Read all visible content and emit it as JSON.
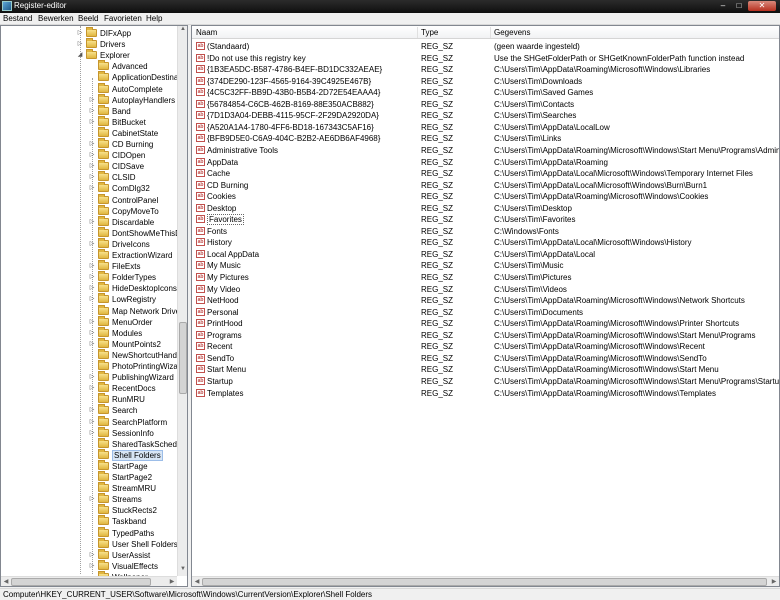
{
  "window": {
    "title": "Register-editor",
    "minimize": "–",
    "maximize": "□",
    "close": "✕"
  },
  "menu": [
    "Bestand",
    "Bewerken",
    "Beeld",
    "Favorieten",
    "Help"
  ],
  "tree": {
    "items": [
      {
        "label": "DIFxApp",
        "level": 1,
        "expander": "▷"
      },
      {
        "label": "Drivers",
        "level": 1,
        "expander": "▷"
      },
      {
        "label": "Explorer",
        "level": 1,
        "expander": "◢"
      },
      {
        "label": "Advanced",
        "level": 2,
        "expander": ""
      },
      {
        "label": "ApplicationDestinations",
        "level": 2,
        "expander": ""
      },
      {
        "label": "AutoComplete",
        "level": 2,
        "expander": ""
      },
      {
        "label": "AutoplayHandlers",
        "level": 2,
        "expander": "▷"
      },
      {
        "label": "Band",
        "level": 2,
        "expander": "▷"
      },
      {
        "label": "BitBucket",
        "level": 2,
        "expander": "▷"
      },
      {
        "label": "CabinetState",
        "level": 2,
        "expander": ""
      },
      {
        "label": "CD Burning",
        "level": 2,
        "expander": "▷"
      },
      {
        "label": "CIDOpen",
        "level": 2,
        "expander": "▷"
      },
      {
        "label": "CIDSave",
        "level": 2,
        "expander": "▷"
      },
      {
        "label": "CLSID",
        "level": 2,
        "expander": "▷"
      },
      {
        "label": "ComDlg32",
        "level": 2,
        "expander": "▷"
      },
      {
        "label": "ControlPanel",
        "level": 2,
        "expander": ""
      },
      {
        "label": "CopyMoveTo",
        "level": 2,
        "expander": ""
      },
      {
        "label": "Discardable",
        "level": 2,
        "expander": "▷"
      },
      {
        "label": "DontShowMeThisDialog",
        "level": 2,
        "expander": ""
      },
      {
        "label": "DriveIcons",
        "level": 2,
        "expander": "▷"
      },
      {
        "label": "ExtractionWizard",
        "level": 2,
        "expander": ""
      },
      {
        "label": "FileExts",
        "level": 2,
        "expander": "▷"
      },
      {
        "label": "FolderTypes",
        "level": 2,
        "expander": "▷"
      },
      {
        "label": "HideDesktopIcons",
        "level": 2,
        "expander": "▷"
      },
      {
        "label": "LowRegistry",
        "level": 2,
        "expander": "▷"
      },
      {
        "label": "Map Network Drive MRU",
        "level": 2,
        "expander": ""
      },
      {
        "label": "MenuOrder",
        "level": 2,
        "expander": "▷"
      },
      {
        "label": "Modules",
        "level": 2,
        "expander": "▷"
      },
      {
        "label": "MountPoints2",
        "level": 2,
        "expander": "▷"
      },
      {
        "label": "NewShortcutHandlers",
        "level": 2,
        "expander": ""
      },
      {
        "label": "PhotoPrintingWizard",
        "level": 2,
        "expander": ""
      },
      {
        "label": "PublishingWizard",
        "level": 2,
        "expander": "▷"
      },
      {
        "label": "RecentDocs",
        "level": 2,
        "expander": "▷"
      },
      {
        "label": "RunMRU",
        "level": 2,
        "expander": ""
      },
      {
        "label": "Search",
        "level": 2,
        "expander": "▷"
      },
      {
        "label": "SearchPlatform",
        "level": 2,
        "expander": "▷"
      },
      {
        "label": "SessionInfo",
        "level": 2,
        "expander": "▷"
      },
      {
        "label": "SharedTaskScheduler",
        "level": 2,
        "expander": ""
      },
      {
        "label": "Shell Folders",
        "level": 2,
        "expander": "",
        "selected": true
      },
      {
        "label": "StartPage",
        "level": 2,
        "expander": ""
      },
      {
        "label": "StartPage2",
        "level": 2,
        "expander": ""
      },
      {
        "label": "StreamMRU",
        "level": 2,
        "expander": ""
      },
      {
        "label": "Streams",
        "level": 2,
        "expander": "▷"
      },
      {
        "label": "StuckRects2",
        "level": 2,
        "expander": ""
      },
      {
        "label": "Taskband",
        "level": 2,
        "expander": ""
      },
      {
        "label": "TypedPaths",
        "level": 2,
        "expander": ""
      },
      {
        "label": "User Shell Folders",
        "level": 2,
        "expander": ""
      },
      {
        "label": "UserAssist",
        "level": 2,
        "expander": "▷"
      },
      {
        "label": "VisualEffects",
        "level": 2,
        "expander": "▷"
      },
      {
        "label": "Wallpaper",
        "level": 2,
        "expander": ""
      }
    ]
  },
  "values": {
    "headers": {
      "name": "Naam",
      "type": "Type",
      "data": "Gegevens"
    },
    "icon_text": "ab",
    "rows": [
      {
        "name": "(Standaard)",
        "type": "REG_SZ",
        "data": "(geen waarde ingesteld)"
      },
      {
        "name": "!Do not use this registry key",
        "type": "REG_SZ",
        "data": "Use the SHGetFolderPath or SHGetKnownFolderPath function instead"
      },
      {
        "name": "{1B3EA5DC-B587-4786-B4EF-BD1DC332AEAE}",
        "type": "REG_SZ",
        "data": "C:\\Users\\Tim\\AppData\\Roaming\\Microsoft\\Windows\\Libraries"
      },
      {
        "name": "{374DE290-123F-4565-9164-39C4925E467B}",
        "type": "REG_SZ",
        "data": "C:\\Users\\Tim\\Downloads"
      },
      {
        "name": "{4C5C32FF-BB9D-43B0-B5B4-2D72E54EAAA4}",
        "type": "REG_SZ",
        "data": "C:\\Users\\Tim\\Saved Games"
      },
      {
        "name": "{56784854-C6CB-462B-8169-88E350ACB882}",
        "type": "REG_SZ",
        "data": "C:\\Users\\Tim\\Contacts"
      },
      {
        "name": "{7D1D3A04-DEBB-4115-95CF-2F29DA2920DA}",
        "type": "REG_SZ",
        "data": "C:\\Users\\Tim\\Searches"
      },
      {
        "name": "{A520A1A4-1780-4FF6-BD18-167343C5AF16}",
        "type": "REG_SZ",
        "data": "C:\\Users\\Tim\\AppData\\LocalLow"
      },
      {
        "name": "{BFB9D5E0-C6A9-404C-B2B2-AE6DB6AF4968}",
        "type": "REG_SZ",
        "data": "C:\\Users\\Tim\\Links"
      },
      {
        "name": "Administrative Tools",
        "type": "REG_SZ",
        "data": "C:\\Users\\Tim\\AppData\\Roaming\\Microsoft\\Windows\\Start Menu\\Programs\\Administrative Tools"
      },
      {
        "name": "AppData",
        "type": "REG_SZ",
        "data": "C:\\Users\\Tim\\AppData\\Roaming"
      },
      {
        "name": "Cache",
        "type": "REG_SZ",
        "data": "C:\\Users\\Tim\\AppData\\Local\\Microsoft\\Windows\\Temporary Internet Files"
      },
      {
        "name": "CD Burning",
        "type": "REG_SZ",
        "data": "C:\\Users\\Tim\\AppData\\Local\\Microsoft\\Windows\\Burn\\Burn1"
      },
      {
        "name": "Cookies",
        "type": "REG_SZ",
        "data": "C:\\Users\\Tim\\AppData\\Roaming\\Microsoft\\Windows\\Cookies"
      },
      {
        "name": "Desktop",
        "type": "REG_SZ",
        "data": "C:\\Users\\Tim\\Desktop"
      },
      {
        "name": "Favorites",
        "type": "REG_SZ",
        "data": "C:\\Users\\Tim\\Favorites",
        "focused": true
      },
      {
        "name": "Fonts",
        "type": "REG_SZ",
        "data": "C:\\Windows\\Fonts"
      },
      {
        "name": "History",
        "type": "REG_SZ",
        "data": "C:\\Users\\Tim\\AppData\\Local\\Microsoft\\Windows\\History"
      },
      {
        "name": "Local AppData",
        "type": "REG_SZ",
        "data": "C:\\Users\\Tim\\AppData\\Local"
      },
      {
        "name": "My Music",
        "type": "REG_SZ",
        "data": "C:\\Users\\Tim\\Music"
      },
      {
        "name": "My Pictures",
        "type": "REG_SZ",
        "data": "C:\\Users\\Tim\\Pictures"
      },
      {
        "name": "My Video",
        "type": "REG_SZ",
        "data": "C:\\Users\\Tim\\Videos"
      },
      {
        "name": "NetHood",
        "type": "REG_SZ",
        "data": "C:\\Users\\Tim\\AppData\\Roaming\\Microsoft\\Windows\\Network Shortcuts"
      },
      {
        "name": "Personal",
        "type": "REG_SZ",
        "data": "C:\\Users\\Tim\\Documents"
      },
      {
        "name": "PrintHood",
        "type": "REG_SZ",
        "data": "C:\\Users\\Tim\\AppData\\Roaming\\Microsoft\\Windows\\Printer Shortcuts"
      },
      {
        "name": "Programs",
        "type": "REG_SZ",
        "data": "C:\\Users\\Tim\\AppData\\Roaming\\Microsoft\\Windows\\Start Menu\\Programs"
      },
      {
        "name": "Recent",
        "type": "REG_SZ",
        "data": "C:\\Users\\Tim\\AppData\\Roaming\\Microsoft\\Windows\\Recent"
      },
      {
        "name": "SendTo",
        "type": "REG_SZ",
        "data": "C:\\Users\\Tim\\AppData\\Roaming\\Microsoft\\Windows\\SendTo"
      },
      {
        "name": "Start Menu",
        "type": "REG_SZ",
        "data": "C:\\Users\\Tim\\AppData\\Roaming\\Microsoft\\Windows\\Start Menu"
      },
      {
        "name": "Startup",
        "type": "REG_SZ",
        "data": "C:\\Users\\Tim\\AppData\\Roaming\\Microsoft\\Windows\\Start Menu\\Programs\\Startup"
      },
      {
        "name": "Templates",
        "type": "REG_SZ",
        "data": "C:\\Users\\Tim\\AppData\\Roaming\\Microsoft\\Windows\\Templates"
      }
    ]
  },
  "statusbar": {
    "path": "Computer\\HKEY_CURRENT_USER\\Software\\Microsoft\\Windows\\CurrentVersion\\Explorer\\Shell Folders"
  }
}
